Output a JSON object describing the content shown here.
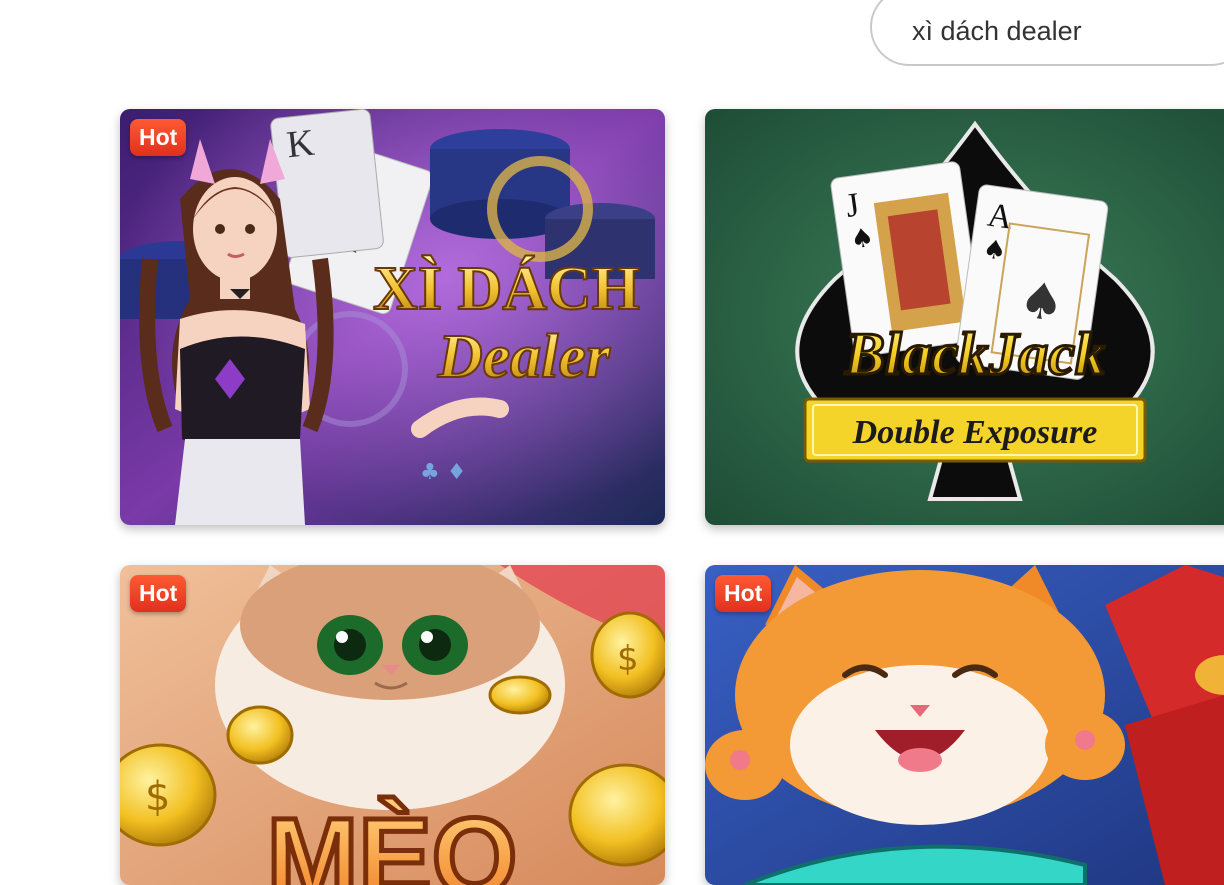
{
  "search": {
    "value": "xì dách dealer"
  },
  "games": [
    {
      "title_line1": "XÌ DÁCH",
      "title_line2": "Dealer",
      "badge": "Hot"
    },
    {
      "title_line1": "BlackJack",
      "title_line2": "Double Exposure",
      "badge": ""
    },
    {
      "title_line1": "MÈO",
      "badge": "Hot"
    },
    {
      "badge": "Hot"
    }
  ],
  "colors": {
    "hot_badge": "#e63b22",
    "blackjack_felt": "#2f6a4a",
    "xidach_bg": "#5a2a8a",
    "meo_bg": "#e8a878",
    "cat2_bg": "#2c4fa0"
  }
}
